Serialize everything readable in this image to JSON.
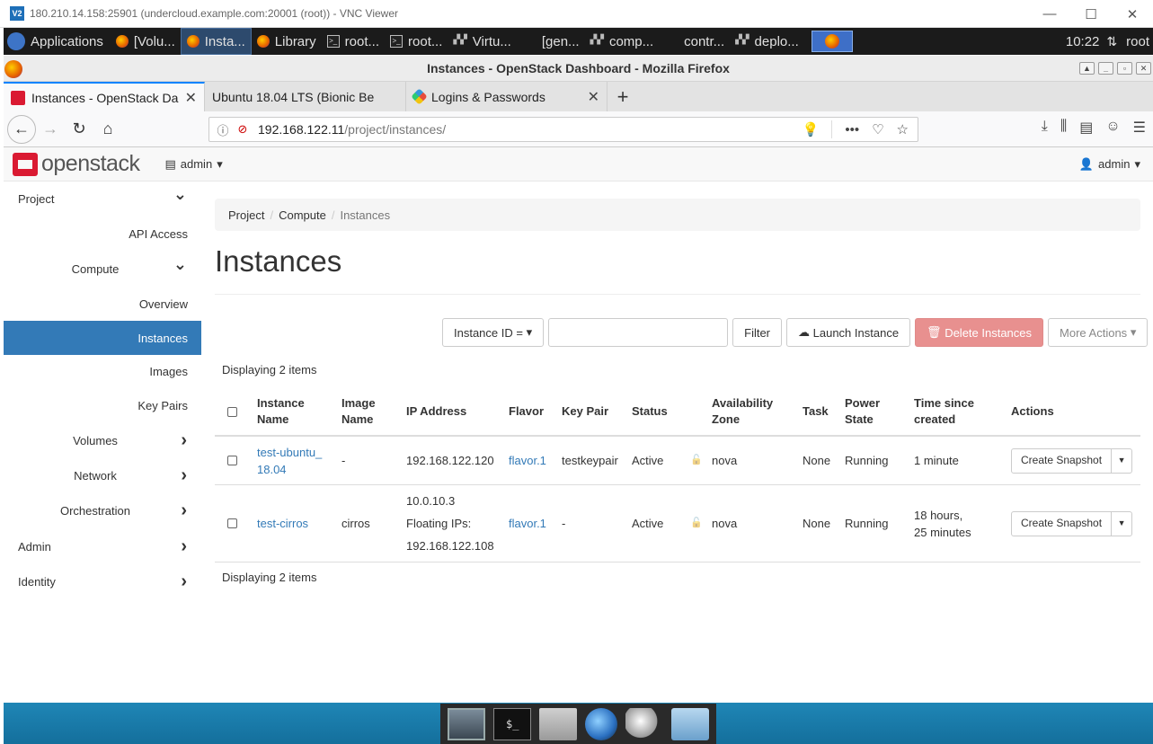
{
  "vnc": {
    "title": "180.210.14.158:25901 (undercloud.example.com:20001 (root)) - VNC Viewer",
    "logo": "V2",
    "controls": [
      "—",
      "☐",
      "✕"
    ]
  },
  "panel": {
    "applications": "Applications",
    "tasks": [
      {
        "icon": "firefox-icon",
        "label": "[Volu..."
      },
      {
        "icon": "firefox-icon",
        "label": "Insta...",
        "active": true
      },
      {
        "icon": "firefox-icon",
        "label": "Library"
      },
      {
        "icon": "terminal-icon",
        "label": "root..."
      },
      {
        "icon": "terminal-icon",
        "label": "root..."
      },
      {
        "icon": "vm-icon",
        "label": "Virtu..."
      },
      {
        "icon": "none",
        "label": "[gen..."
      },
      {
        "icon": "vm-icon",
        "label": "comp..."
      },
      {
        "icon": "none",
        "label": "contr..."
      },
      {
        "icon": "vm-icon",
        "label": "deplo..."
      }
    ],
    "clock": "10:22",
    "user": "root"
  },
  "firefox": {
    "window_title": "Instances - OpenStack Dashboard - Mozilla Firefox",
    "tabs": [
      {
        "title": "Instances - OpenStack Da",
        "active": true,
        "favicon": "openstack"
      },
      {
        "title": "Ubuntu 18.04 LTS (Bionic Be",
        "active": false,
        "favicon": "none"
      },
      {
        "title": "Logins & Passwords",
        "active": false,
        "favicon": "passwords"
      }
    ],
    "url_host": "192.168.122.11",
    "url_path": "/project/instances/"
  },
  "dashboard": {
    "logo_text": "openstack",
    "project_selector": "admin",
    "user_menu": "admin",
    "sidebar": [
      {
        "label": "Project",
        "level": 0,
        "chevron": "down"
      },
      {
        "label": "API Access",
        "level": 2
      },
      {
        "label": "Compute",
        "level": 1,
        "chevron": "down"
      },
      {
        "label": "Overview",
        "level": 2
      },
      {
        "label": "Instances",
        "level": 2,
        "active": true
      },
      {
        "label": "Images",
        "level": 2
      },
      {
        "label": "Key Pairs",
        "level": 2
      },
      {
        "label": "Volumes",
        "level": 1,
        "chevron": "right"
      },
      {
        "label": "Network",
        "level": 1,
        "chevron": "right"
      },
      {
        "label": "Orchestration",
        "level": 1,
        "chevron": "right"
      },
      {
        "label": "Admin",
        "level": 0,
        "chevron": "right"
      },
      {
        "label": "Identity",
        "level": 0,
        "chevron": "right"
      }
    ],
    "breadcrumb": [
      "Project",
      "Compute",
      "Instances"
    ],
    "page_title": "Instances",
    "toolbar": {
      "filter_field": "Instance ID =",
      "filter_value": "",
      "filter_button": "Filter",
      "launch": "Launch Instance",
      "delete": "Delete Instances",
      "more": "More Actions"
    },
    "count_text": "Displaying 2 items",
    "columns": [
      [
        "Instance",
        "Name"
      ],
      [
        "Image",
        "Name"
      ],
      [
        "IP Address"
      ],
      [
        "Flavor"
      ],
      [
        "Key Pair"
      ],
      [
        "Status"
      ],
      [
        "Availability",
        "Zone"
      ],
      [
        "Task"
      ],
      [
        "Power",
        "State"
      ],
      [
        "Time since",
        "created"
      ],
      [
        "Actions"
      ]
    ],
    "rows": [
      {
        "name": [
          "test-ubuntu_",
          "18.04"
        ],
        "image": "-",
        "ip": [
          "192.168.122.120"
        ],
        "flavor": "flavor.1",
        "keypair": "testkeypair",
        "status": "Active",
        "zone": "nova",
        "task": "None",
        "power": "Running",
        "time": [
          "1 minute"
        ],
        "action": "Create Snapshot"
      },
      {
        "name": [
          "test-cirros"
        ],
        "image": "cirros",
        "ip": [
          "10.0.10.3",
          "Floating IPs:",
          "192.168.122.108"
        ],
        "flavor": "flavor.1",
        "keypair": "-",
        "status": "Active",
        "zone": "nova",
        "task": "None",
        "power": "Running",
        "time": [
          "18 hours,",
          "25 minutes"
        ],
        "action": "Create Snapshot"
      }
    ]
  }
}
